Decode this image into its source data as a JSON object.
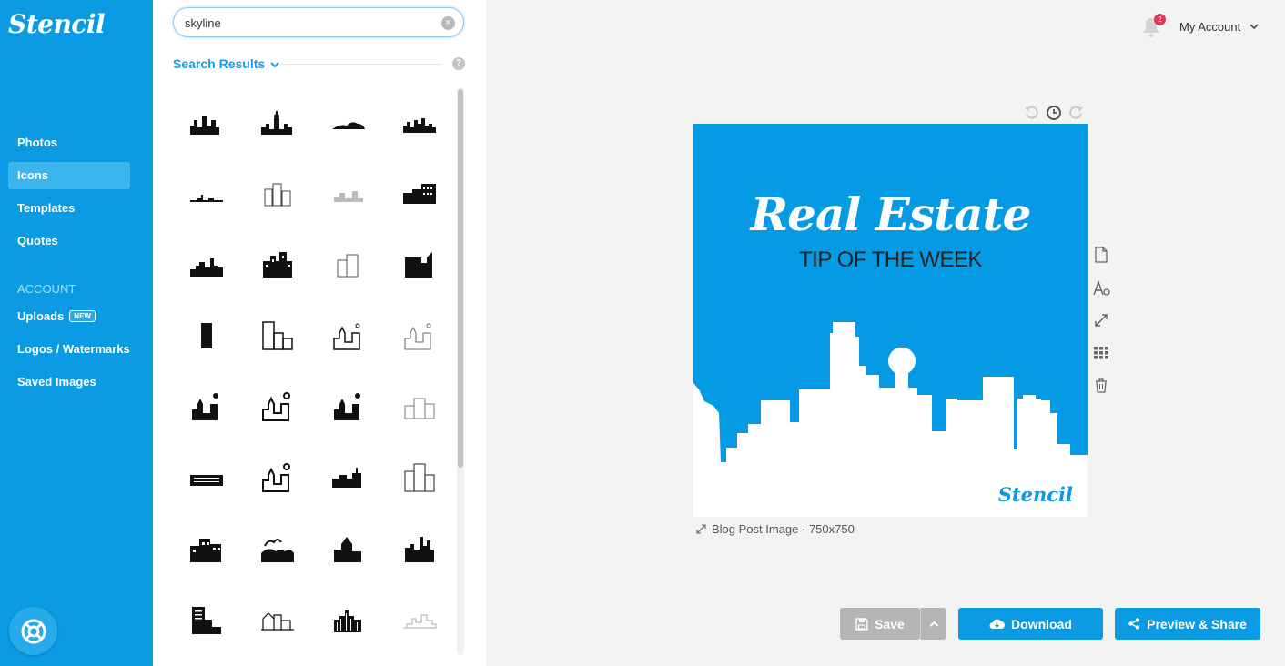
{
  "app": {
    "logo": "Stencil"
  },
  "sidebar": {
    "items": [
      {
        "label": "Photos"
      },
      {
        "label": "Icons"
      },
      {
        "label": "Templates"
      },
      {
        "label": "Quotes"
      }
    ],
    "account_heading": "ACCOUNT",
    "account_items": [
      {
        "label": "Uploads",
        "badge": "NEW"
      },
      {
        "label": "Logos / Watermarks"
      },
      {
        "label": "Saved Images"
      }
    ],
    "active_item": "Icons"
  },
  "search": {
    "value": "skyline",
    "clear_symbol": "×"
  },
  "results": {
    "title": "Search Results",
    "help_symbol": "?"
  },
  "header": {
    "notification_count": "2",
    "account_label": "My Account"
  },
  "canvas": {
    "headline": "Real Estate",
    "subheadline": "TIP OF THE WEEK",
    "watermark": "Stencil",
    "background_color": "#059be4",
    "caption": "Blog Post Image · 750x750"
  },
  "actions": {
    "save": "Save",
    "download": "Download",
    "preview_share": "Preview & Share"
  },
  "colors": {
    "brand": "#0a9be3",
    "active_nav": "#3cb4ee",
    "badge": "#e0385b",
    "disabled": "#b5b5b5"
  }
}
